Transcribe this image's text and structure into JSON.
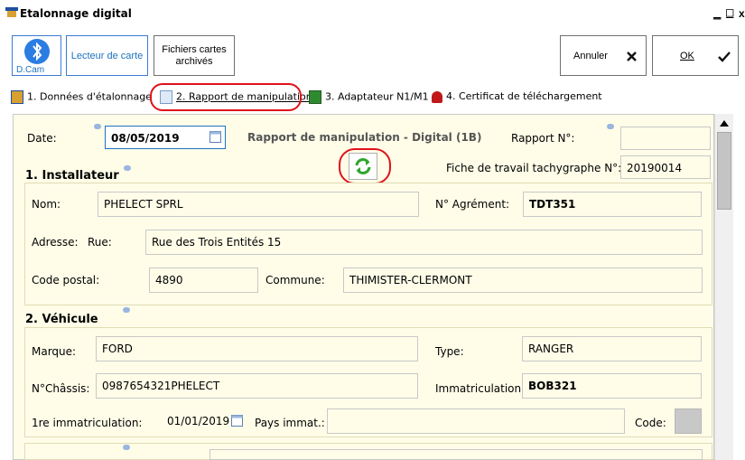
{
  "window": {
    "title": "Etalonnage digital",
    "controls": [
      "_",
      "□"
    ]
  },
  "toolbar": {
    "dcam_label": "D.Cam",
    "card_reader_label": "Lecteur de carte",
    "archived_cards_label": "Fichiers cartes archivés",
    "cancel_label": "Annuler",
    "ok_label": "OK"
  },
  "tabs": [
    {
      "label": "1. Données d'étalonnage"
    },
    {
      "label": "2. Rapport de manipulation"
    },
    {
      "label": "3. Adaptateur N1/M1"
    },
    {
      "label": "4. Certificat de téléchargement"
    }
  ],
  "report": {
    "date_label": "Date:",
    "date_value": "08/05/2019",
    "heading": "Rapport de manipulation - Digital (1B)",
    "report_no_label": "Rapport N°:",
    "report_no_value": "",
    "worksheet_label": "Fiche de travail tachygraphe N°:",
    "worksheet_value": "20190014"
  },
  "installer": {
    "section_title": "1. Installateur",
    "name_label": "Nom:",
    "name_value": "PHELECT SPRL",
    "approval_label": "N° Agrément:",
    "approval_value": "TDT351",
    "address_label": "Adresse:",
    "street_label": "Rue:",
    "street_value": "Rue des Trois Entités 15",
    "postal_label": "Code postal:",
    "postal_value": "4890",
    "town_label": "Commune:",
    "town_value": "THIMISTER-CLERMONT"
  },
  "vehicle": {
    "section_title": "2. Véhicule",
    "make_label": "Marque:",
    "make_value": "FORD",
    "type_label": "Type:",
    "type_value": "RANGER",
    "chassis_label": "N°Châssis:",
    "chassis_value": "0987654321PHELECT",
    "registration_label": "Immatriculation:",
    "registration_value": "BOB321",
    "first_reg_label": "1re immatriculation:",
    "first_reg_value": "01/01/2019",
    "country_label": "Pays immat.:",
    "country_value": "",
    "code_label": "Code:",
    "code_value": ""
  },
  "colors": {
    "highlight_red": "#e0121a",
    "panel_bg": "#fffde8",
    "accent_blue": "#1e73be"
  }
}
